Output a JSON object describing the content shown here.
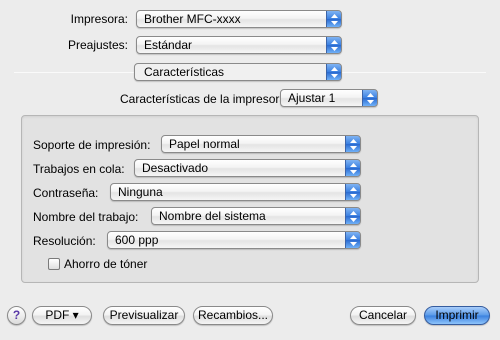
{
  "printer": {
    "label": "Impresora:",
    "value": "Brother MFC-xxxx"
  },
  "presets": {
    "label": "Preajustes:",
    "value": "Estándar"
  },
  "panel_menu": {
    "value": "Características"
  },
  "features": {
    "label": "Características de la impresora:",
    "value": "Ajustar 1"
  },
  "options": [
    {
      "label": "Soporte de impresión:",
      "value": "Papel normal"
    },
    {
      "label": "Trabajos en cola:",
      "value": "Desactivado"
    },
    {
      "label": "Contraseña:",
      "value": "Ninguna"
    },
    {
      "label": "Nombre del trabajo:",
      "value": "Nombre del sistema"
    },
    {
      "label": "Resolución:",
      "value": "600 ppp"
    }
  ],
  "toner_save": {
    "label": "Ahorro de tóner",
    "checked": false
  },
  "bottom": {
    "help": "?",
    "pdf": "PDF ▾",
    "preview": "Previsualizar",
    "supplies": "Recambios...",
    "cancel": "Cancelar",
    "print": "Imprimir"
  },
  "colors": {
    "accent": "#3a80df"
  }
}
